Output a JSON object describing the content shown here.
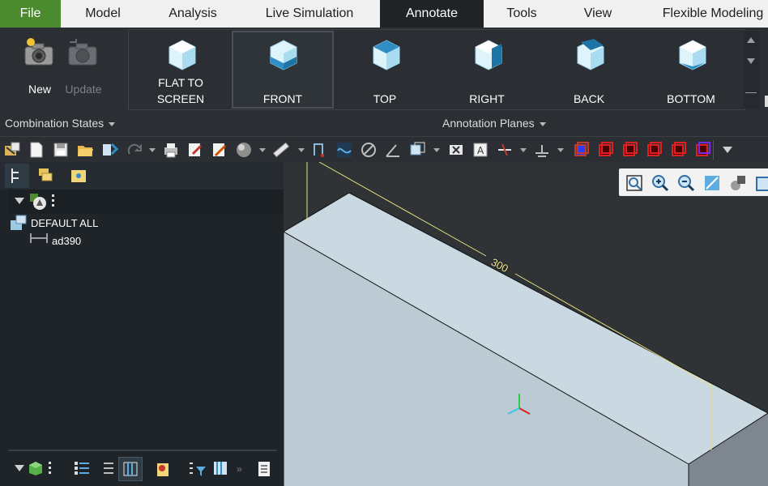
{
  "menu": {
    "tabs": [
      {
        "label": "File"
      },
      {
        "label": "Model"
      },
      {
        "label": "Analysis"
      },
      {
        "label": "Live Simulation"
      },
      {
        "label": "Annotate"
      },
      {
        "label": "Tools"
      },
      {
        "label": "View"
      },
      {
        "label": "Flexible Modeling"
      }
    ],
    "active_tab": "Annotate"
  },
  "ribbon": {
    "combination_states": {
      "group_label": "Combination States",
      "new_label": "New",
      "update_label": "Update"
    },
    "annotation_planes": {
      "group_label": "Annotation Planes",
      "buttons": [
        {
          "label": "FLAT TO\nSCREEN",
          "line1": "FLAT TO",
          "line2": "SCREEN"
        },
        {
          "label": "FRONT"
        },
        {
          "label": "TOP"
        },
        {
          "label": "RIGHT"
        },
        {
          "label": "BACK"
        },
        {
          "label": "BOTTOM"
        }
      ],
      "selected": "FRONT"
    }
  },
  "tree": {
    "root_label": "DEFAULT ALL",
    "child_label": "ad390"
  },
  "viewport": {
    "dimension_value": "300"
  },
  "colors": {
    "file_tab": "#4c8a2f",
    "active_tab": "#1f2326",
    "dimension_line": "#e8e07a",
    "model_face": "#c9d6de"
  }
}
